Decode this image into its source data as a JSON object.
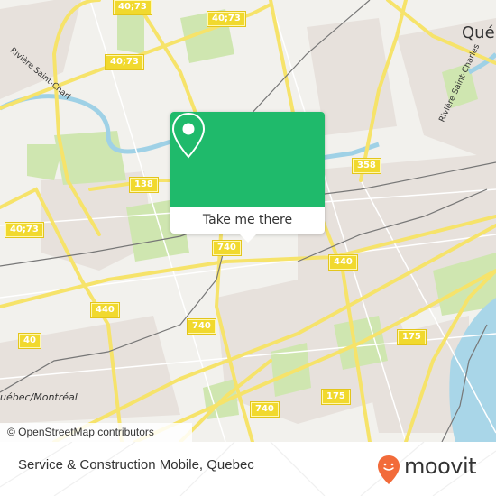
{
  "map": {
    "colors": {
      "background": "#f2f1ed",
      "road_major": "#f6e36a",
      "road_minor": "#ffffff",
      "water": "#a9d6e8",
      "park": "#cfe6b0",
      "urban": "#e7e1dc",
      "rail": "#777777",
      "river": "#9fd1e6"
    },
    "route_shields": [
      {
        "id": "shield-40-73-a",
        "label": "40;73"
      },
      {
        "id": "shield-40-73-b",
        "label": "40;73"
      },
      {
        "id": "shield-40-73-c",
        "label": "40;73"
      },
      {
        "id": "shield-40-73-d",
        "label": "40;73"
      },
      {
        "id": "shield-138",
        "label": "138"
      },
      {
        "id": "shield-358",
        "label": "358"
      },
      {
        "id": "shield-740-a",
        "label": "740"
      },
      {
        "id": "shield-740-b",
        "label": "740"
      },
      {
        "id": "shield-740-c",
        "label": "740"
      },
      {
        "id": "shield-440-a",
        "label": "440"
      },
      {
        "id": "shield-440-b",
        "label": "440"
      },
      {
        "id": "shield-40",
        "label": "40"
      },
      {
        "id": "shield-175-a",
        "label": "175"
      },
      {
        "id": "shield-175-b",
        "label": "175"
      }
    ],
    "place_labels": {
      "quebec": "Qué",
      "quebec_montreal": "uébec/Montréal",
      "river_west": "Rivière Saint-Charl",
      "river_east": "Rivière Saint-Charles"
    },
    "attribution": "© OpenStreetMap contributors"
  },
  "popup": {
    "icon": "map-pin-icon",
    "action_label": "Take me there",
    "color": "#1fba6b"
  },
  "footer": {
    "title": "Service & Construction Mobile, Quebec",
    "brand": "moovit",
    "brand_color": "#f26b3a"
  }
}
